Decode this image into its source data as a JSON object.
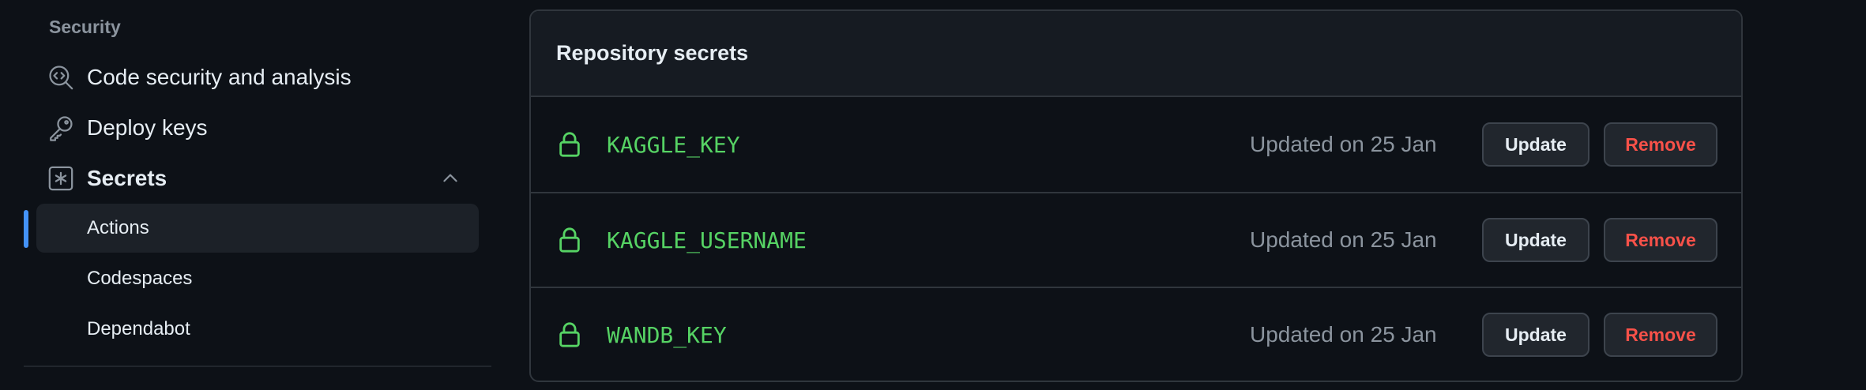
{
  "sidebar": {
    "section_heading": "Security",
    "items": [
      {
        "label": "Code security and analysis",
        "icon": "codescan-icon"
      },
      {
        "label": "Deploy keys",
        "icon": "key-icon"
      },
      {
        "label": "Secrets",
        "icon": "asterisk-box-icon",
        "expanded": true
      }
    ],
    "subitems": [
      {
        "label": "Actions",
        "active": true
      },
      {
        "label": "Codespaces",
        "active": false
      },
      {
        "label": "Dependabot",
        "active": false
      }
    ]
  },
  "panel": {
    "title": "Repository secrets",
    "secrets": [
      {
        "name": "KAGGLE_KEY",
        "updated": "Updated on 25 Jan",
        "update_label": "Update",
        "remove_label": "Remove"
      },
      {
        "name": "KAGGLE_USERNAME",
        "updated": "Updated on 25 Jan",
        "update_label": "Update",
        "remove_label": "Remove"
      },
      {
        "name": "WANDB_KEY",
        "updated": "Updated on 25 Jan",
        "update_label": "Update",
        "remove_label": "Remove"
      }
    ]
  },
  "colors": {
    "background": "#0d1117",
    "accent": "#4493f8",
    "secret_name": "#56d364",
    "danger": "#f85149",
    "muted": "#8b949e"
  }
}
